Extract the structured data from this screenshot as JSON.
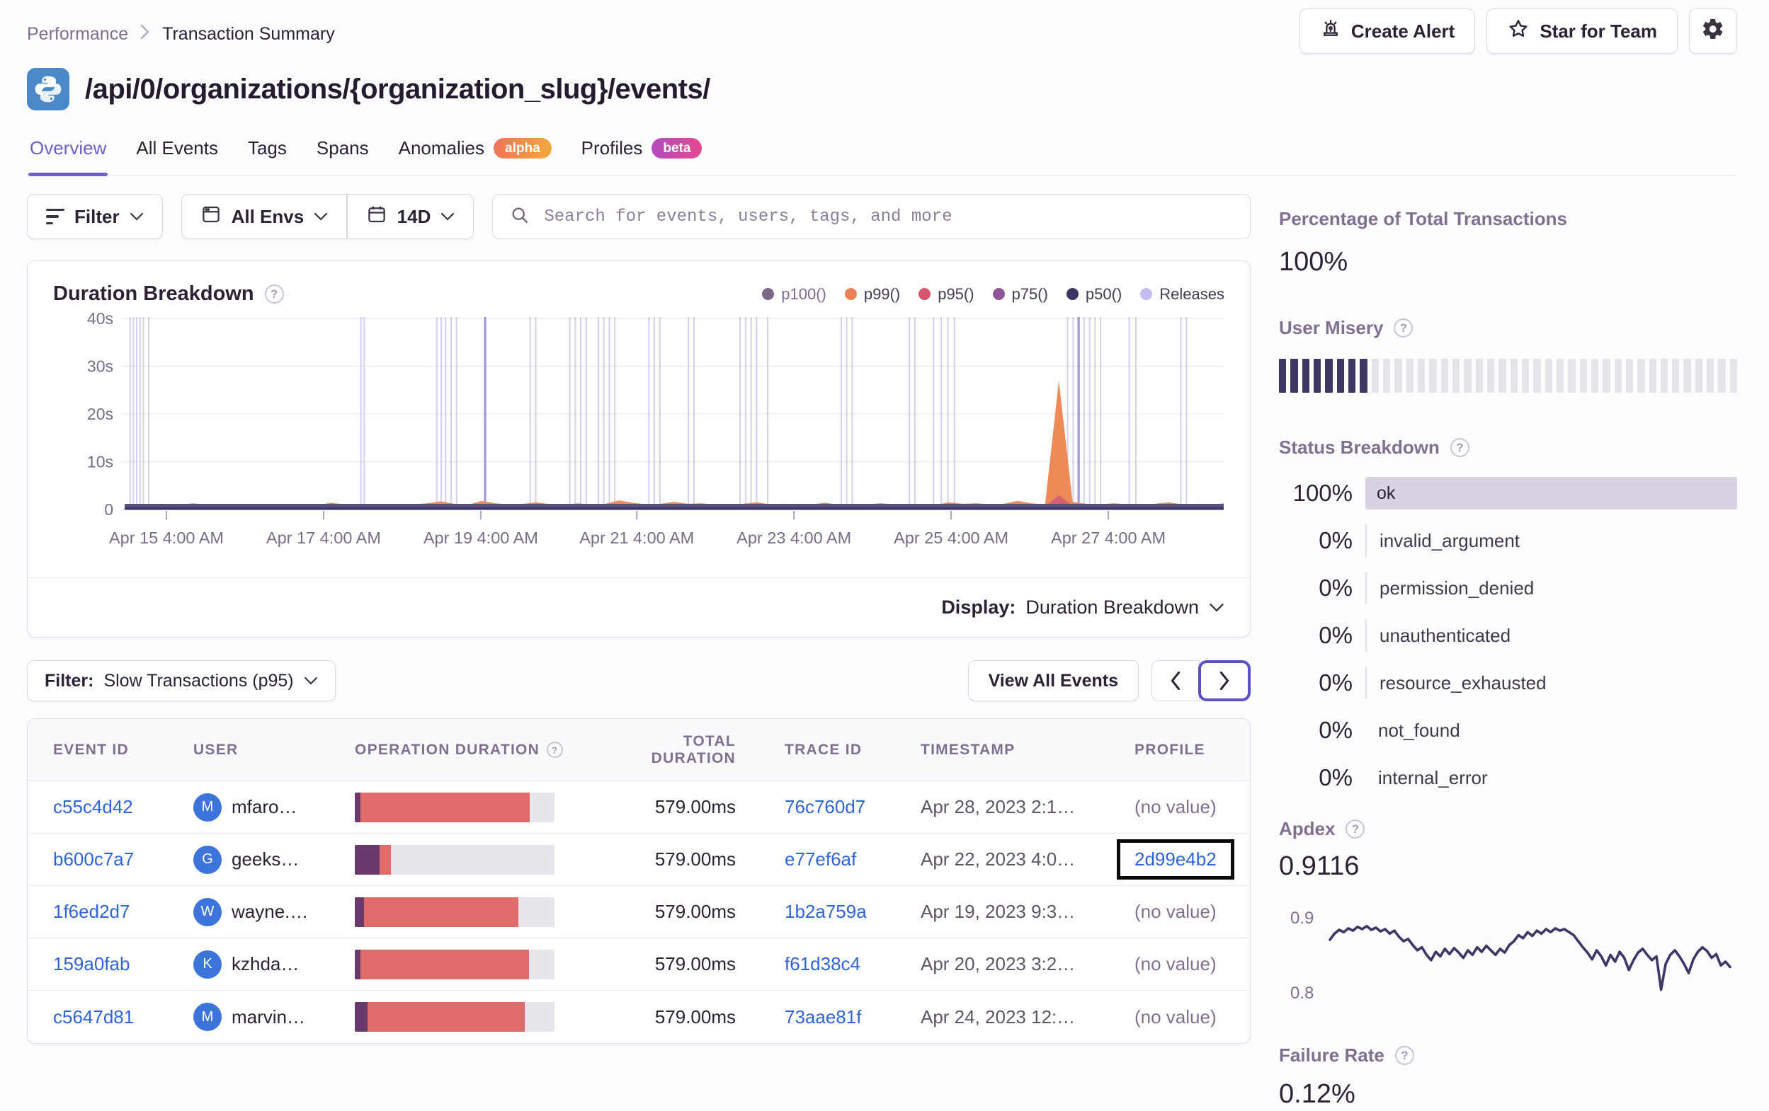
{
  "breadcrumb": {
    "items": [
      "Performance",
      "Transaction Summary"
    ]
  },
  "header": {
    "title": "/api/0/organizations/{organization_slug}/events/",
    "language_icon": "python-icon",
    "actions": {
      "create_alert": "Create Alert",
      "star_for_team": "Star for Team",
      "settings_icon": "gear-icon"
    }
  },
  "tabs": [
    {
      "label": "Overview",
      "active": true
    },
    {
      "label": "All Events"
    },
    {
      "label": "Tags"
    },
    {
      "label": "Spans"
    },
    {
      "label": "Anomalies",
      "badge": {
        "label": "alpha",
        "kind": "alpha"
      }
    },
    {
      "label": "Profiles",
      "badge": {
        "label": "beta",
        "kind": "beta"
      }
    }
  ],
  "controls": {
    "filter_label": "Filter",
    "env_label": "All Envs",
    "date_label": "14D",
    "search_placeholder": "Search for events, users, tags, and more"
  },
  "duration_chart": {
    "title": "Duration Breakdown",
    "display_label": "Display:",
    "display_value": "Duration Breakdown",
    "legend": [
      {
        "label": "p100()",
        "color": "#7A6889",
        "text": "#7C6C93"
      },
      {
        "label": "p99()",
        "color": "#ED8152",
        "text": "#453C50"
      },
      {
        "label": "p95()",
        "color": "#D6566F",
        "text": "#453C50"
      },
      {
        "label": "p75()",
        "color": "#8E5599",
        "text": "#453C50"
      },
      {
        "label": "p50()",
        "color": "#3E3565",
        "text": "#453C50"
      },
      {
        "label": "Releases",
        "color": "#C6BCEF",
        "text": "#453C50"
      }
    ],
    "y_ticks": [
      {
        "label": "40s",
        "v": 40
      },
      {
        "label": "30s",
        "v": 30
      },
      {
        "label": "20s",
        "v": 20
      },
      {
        "label": "10s",
        "v": 10
      },
      {
        "label": "0",
        "v": 0
      }
    ],
    "x_ticks": [
      {
        "label": "Apr 15 4:00 AM",
        "f": 0.038
      },
      {
        "label": "Apr 17 4:00 AM",
        "f": 0.181
      },
      {
        "label": "Apr 19 4:00 AM",
        "f": 0.324
      },
      {
        "label": "Apr 21 4:00 AM",
        "f": 0.466
      },
      {
        "label": "Apr 23 4:00 AM",
        "f": 0.609
      },
      {
        "label": "Apr 25 4:00 AM",
        "f": 0.752
      },
      {
        "label": "Apr 27 4:00 AM",
        "f": 0.895
      }
    ],
    "ylim": [
      0,
      40
    ],
    "release_lines": [
      0.005,
      0.008,
      0.011,
      0.014,
      0.017,
      0.022,
      0.215,
      0.218,
      0.284,
      0.288,
      0.292,
      0.297,
      0.302,
      0.328,
      0.369,
      0.374,
      0.405,
      0.41,
      0.415,
      0.42,
      0.431,
      0.436,
      0.441,
      0.446,
      0.477,
      0.482,
      0.487,
      0.513,
      0.518,
      0.56,
      0.565,
      0.57,
      0.575,
      0.585,
      0.652,
      0.657,
      0.662,
      0.714,
      0.719,
      0.736,
      0.743,
      0.749,
      0.755,
      0.858,
      0.863,
      0.868,
      0.873,
      0.878,
      0.883,
      0.888,
      0.914,
      0.92,
      0.961,
      0.966
    ],
    "release_lines_strong": [
      0.328,
      0.868
    ],
    "series": [
      {
        "name": "p99",
        "color": "#EE8A57",
        "values": [
          1.0,
          1.2,
          0.9,
          1.1,
          1.0,
          1.3,
          1.0,
          0.9,
          1.1,
          1.0,
          1.2,
          0.9,
          1.0,
          1.1,
          0.9,
          1.4,
          1.1,
          1.0,
          1.2,
          0.9,
          1.0,
          1.1,
          1.3,
          1.7,
          1.2,
          1.0,
          1.8,
          1.3,
          1.1,
          1.2,
          1.5,
          1.1,
          1.0,
          1.3,
          1.0,
          1.2,
          1.9,
          1.4,
          1.1,
          1.2,
          1.6,
          1.2,
          1.3,
          1.0,
          1.0,
          1.2,
          1.5,
          1.1,
          1.2,
          1.0,
          1.1,
          1.4,
          1.0,
          1.2,
          1.1,
          1.3,
          1.1,
          1.0,
          1.2,
          1.0,
          1.5,
          1.2,
          1.3,
          1.1,
          1.2,
          1.8,
          1.3,
          1.1,
          27.0,
          1.6,
          1.2,
          1.1,
          1.3,
          1.1,
          1.0,
          1.2,
          1.5,
          1.1,
          1.2,
          1.0,
          1.3
        ]
      },
      {
        "name": "p95",
        "color": "#D6606E",
        "values": [
          0.5,
          0.6,
          0.5,
          0.6,
          0.5,
          0.7,
          0.5,
          0.5,
          0.6,
          0.5,
          0.6,
          0.5,
          0.5,
          0.6,
          0.5,
          0.7,
          0.6,
          0.5,
          0.6,
          0.5,
          0.5,
          0.6,
          0.7,
          0.9,
          0.6,
          0.5,
          0.9,
          0.7,
          0.6,
          0.6,
          0.8,
          0.6,
          0.5,
          0.7,
          0.5,
          0.6,
          1.0,
          0.7,
          0.6,
          0.6,
          0.8,
          0.6,
          0.7,
          0.5,
          0.5,
          0.6,
          0.8,
          0.6,
          0.6,
          0.5,
          0.6,
          0.7,
          0.5,
          0.6,
          0.6,
          0.7,
          0.6,
          0.5,
          0.6,
          0.5,
          0.8,
          0.6,
          0.7,
          0.6,
          0.6,
          0.9,
          0.7,
          0.6,
          3.0,
          0.8,
          0.6,
          0.6,
          0.7,
          0.6,
          0.5,
          0.6,
          0.8,
          0.6,
          0.6,
          0.5,
          0.7
        ]
      }
    ],
    "baseline_band_colors": [
      "#565077",
      "#3E3565"
    ],
    "release_color": "#7668C9"
  },
  "table_section": {
    "filter_label": "Filter:",
    "filter_value": "Slow Transactions (p95)",
    "view_all_label": "View All Events",
    "columns": [
      "EVENT ID",
      "USER",
      "OPERATION DURATION",
      "TOTAL DURATION",
      "TRACE ID",
      "TIMESTAMP",
      "PROFILE"
    ],
    "rows": [
      {
        "event_id": "c55c4d42",
        "user_initial": "M",
        "user_name": "mfaro…",
        "op_purple": 0.03,
        "op_red": 0.845,
        "total": "579.00ms",
        "trace_id": "76c760d7",
        "timestamp": "Apr 28, 2023 2:1…",
        "profile": "(no value)",
        "profile_link": false,
        "profile_focused": false
      },
      {
        "event_id": "b600c7a7",
        "user_initial": "G",
        "user_name": "geeks…",
        "op_purple": 0.125,
        "op_red": 0.055,
        "total": "579.00ms",
        "trace_id": "e77ef6af",
        "timestamp": "Apr 22, 2023 4:0…",
        "profile": "2d99e4b2",
        "profile_link": true,
        "profile_focused": true
      },
      {
        "event_id": "1f6ed2d7",
        "user_initial": "W",
        "user_name": "wayne.…",
        "op_purple": 0.045,
        "op_red": 0.775,
        "total": "579.00ms",
        "trace_id": "1b2a759a",
        "timestamp": "Apr 19, 2023 9:3…",
        "profile": "(no value)",
        "profile_link": false,
        "profile_focused": false
      },
      {
        "event_id": "159a0fab",
        "user_initial": "K",
        "user_name": "kzhda…",
        "op_purple": 0.028,
        "op_red": 0.845,
        "total": "579.00ms",
        "trace_id": "f61d38c4",
        "timestamp": "Apr 20, 2023 3:2…",
        "profile": "(no value)",
        "profile_link": false,
        "profile_focused": false
      },
      {
        "event_id": "c5647d81",
        "user_initial": "M",
        "user_name": "marvin…",
        "op_purple": 0.065,
        "op_red": 0.785,
        "total": "579.00ms",
        "trace_id": "73aae81f",
        "timestamp": "Apr 24, 2023 12:…",
        "profile": "(no value)",
        "profile_link": false,
        "profile_focused": false
      }
    ]
  },
  "sidebar": {
    "total_transactions": {
      "title": "Percentage of Total Transactions",
      "value": "100%"
    },
    "user_misery": {
      "title": "User Misery",
      "total_cells": 40,
      "filled_cells": 8,
      "filled_color": "#3E3862",
      "empty_color": "#E6E3EA"
    },
    "status_breakdown": {
      "title": "Status Breakdown",
      "rows": [
        {
          "value": "100%",
          "label": "ok",
          "type": "bar"
        },
        {
          "value": "0%",
          "label": "invalid_argument",
          "type": "line"
        },
        {
          "value": "0%",
          "label": "permission_denied",
          "type": "line"
        },
        {
          "value": "0%",
          "label": "unauthenticated",
          "type": "line"
        },
        {
          "value": "0%",
          "label": "resource_exhausted",
          "type": "line"
        },
        {
          "value": "0%",
          "label": "not_found",
          "type": "plain"
        },
        {
          "value": "0%",
          "label": "internal_error",
          "type": "plain"
        }
      ]
    },
    "apdex": {
      "title": "Apdex",
      "value": "0.9116",
      "y_top": "0.9",
      "y_bottom": "0.8",
      "line_color": "#3E3766",
      "ylim": [
        0.8,
        0.9
      ],
      "values": [
        0.872,
        0.88,
        0.885,
        0.882,
        0.887,
        0.884,
        0.889,
        0.886,
        0.89,
        0.885,
        0.888,
        0.883,
        0.886,
        0.88,
        0.884,
        0.876,
        0.87,
        0.873,
        0.865,
        0.858,
        0.862,
        0.852,
        0.845,
        0.856,
        0.85,
        0.86,
        0.853,
        0.861,
        0.855,
        0.848,
        0.858,
        0.852,
        0.862,
        0.856,
        0.864,
        0.858,
        0.852,
        0.86,
        0.855,
        0.865,
        0.87,
        0.878,
        0.874,
        0.882,
        0.877,
        0.884,
        0.88,
        0.886,
        0.882,
        0.887,
        0.884,
        0.886,
        0.882,
        0.878,
        0.87,
        0.862,
        0.855,
        0.846,
        0.858,
        0.85,
        0.838,
        0.852,
        0.843,
        0.856,
        0.848,
        0.832,
        0.845,
        0.855,
        0.86,
        0.852,
        0.845,
        0.85,
        0.806,
        0.84,
        0.852,
        0.858,
        0.85,
        0.84,
        0.828,
        0.846,
        0.856,
        0.862,
        0.857,
        0.848,
        0.853,
        0.838,
        0.843,
        0.836
      ]
    },
    "failure_rate": {
      "title": "Failure Rate",
      "value": "0.12%"
    }
  },
  "colors": {
    "accent": "#6C5FC7",
    "link": "#2F64D8",
    "muted": "#80708F"
  }
}
